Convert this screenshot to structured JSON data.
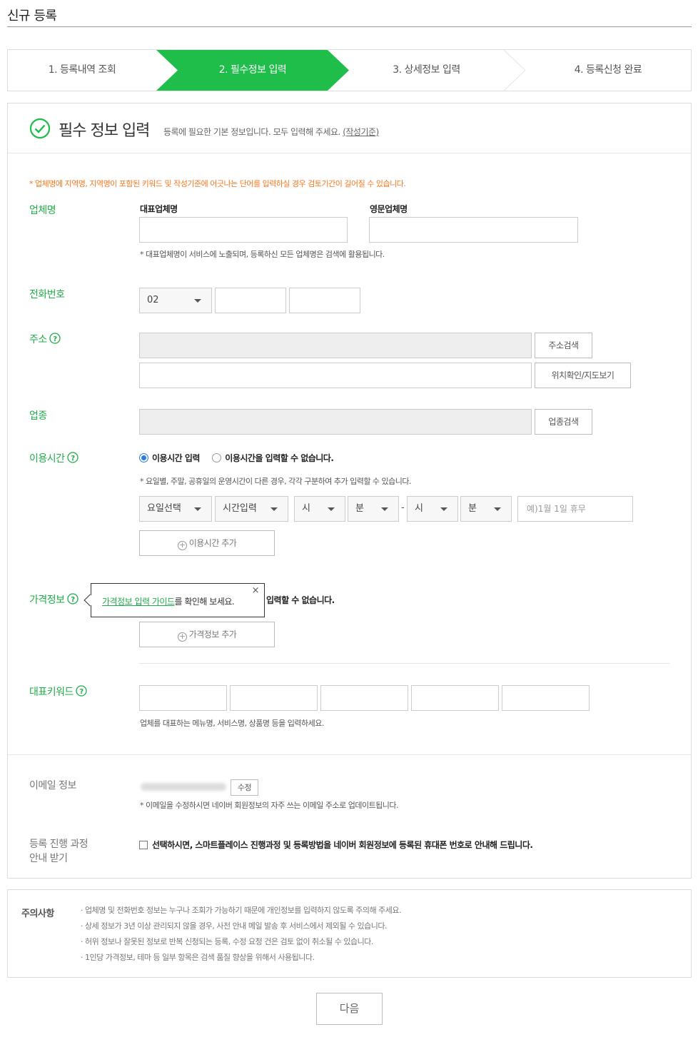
{
  "page": {
    "title": "신규 등록"
  },
  "steps": [
    {
      "label": "1. 등록내역 조회"
    },
    {
      "label": "2. 필수정보 입력"
    },
    {
      "label": "3. 상세정보 입력"
    },
    {
      "label": "4. 등록신청 완료"
    }
  ],
  "colors": {
    "accent": "#1fbd4a",
    "label_green": "#1fae4a",
    "warning": "#f47920"
  },
  "section": {
    "title": "필수 정보 입력",
    "desc": "등록에 필요한 기본 정보입니다. 모두 입력해 주세요.",
    "criteria_link": "(작성기준)",
    "warning": "* 업체명에 지역명, 지역명이 포함된 키워드 및 작성기준에 어긋나는 단어를 입력하실 경우 검토기간이 길어질 수 있습니다."
  },
  "business_name": {
    "label": "업체명",
    "rep_label": "대표업체명",
    "rep_value": "",
    "eng_label": "영문업체명",
    "eng_value": "",
    "note": "* 대표업체명이 서비스에 노출되며, 등록하신 모든 업체명은 검색에 활용됩니다."
  },
  "phone": {
    "label": "전화번호",
    "area_code": "02",
    "part2": "",
    "part3": ""
  },
  "address": {
    "label": "주소",
    "search_button": "주소검색",
    "map_button": "위치확인/지도보기"
  },
  "category": {
    "label": "업종",
    "search_button": "업종검색"
  },
  "hours": {
    "label": "이용시간",
    "option_input": "이용시간 입력",
    "option_none": "이용시간을 입력할 수 없습니다.",
    "note": "* 요일별, 주말, 공휴일의 운영시간이 다른 경우, 각각 구분하여 추가 입력할 수 있습니다.",
    "day_select": "요일선택",
    "time_select": "시간입력",
    "hour_start": "시",
    "min_start": "분",
    "dash": "-",
    "hour_end": "시",
    "min_end": "분",
    "holiday_placeholder": "예)1월 1일 휴무",
    "add_button": "이용시간 추가"
  },
  "price": {
    "label": "가격정보",
    "option_none_suffix": "입력할 수 없습니다.",
    "add_button": "가격정보 추가",
    "tooltip_link": "가격정보 입력 가이드",
    "tooltip_text": "를 확인해 보세요.",
    "tooltip_close": "×"
  },
  "keywords": {
    "label": "대표키워드",
    "note": "업체를 대표하는 메뉴명, 서비스명, 상품명 등을 입력하세요."
  },
  "email": {
    "label": "이메일 정보",
    "edit_button": "수정",
    "note": "* 이메일을 수정하시면 네이버 회원정보의 자주 쓰는 이메일 주소로 업데이트됩니다."
  },
  "progress_notice": {
    "label_line1": "등록 진행 과정",
    "label_line2": "안내 받기",
    "checkbox_text": "선택하시면, 스마트플레이스 진행과정 및 등록방법을 네이버 회원정보에 등록된 휴대폰 번호로 안내해 드립니다."
  },
  "caution": {
    "title": "주의사항",
    "items": [
      "업체명 및 전화번호 정보는 누구나 조회가 가능하기 때문에 개인정보를 입력하지 않도록 주의해 주세요.",
      "상세 정보가 3년 이상 관리되지 않을 경우, 사전 안내 메일 발송 후 서비스에서 제외될 수 있습니다.",
      "허위 정보나 잘못된 정보로 반복 신청되는 등록, 수정 요청 건은 검토 없이 취소될 수 있습니다.",
      "1인당 가격정보, 테마 등 일부 항목은 검색 품질 향상을 위해서 사용됩니다."
    ]
  },
  "next_button": "다음"
}
